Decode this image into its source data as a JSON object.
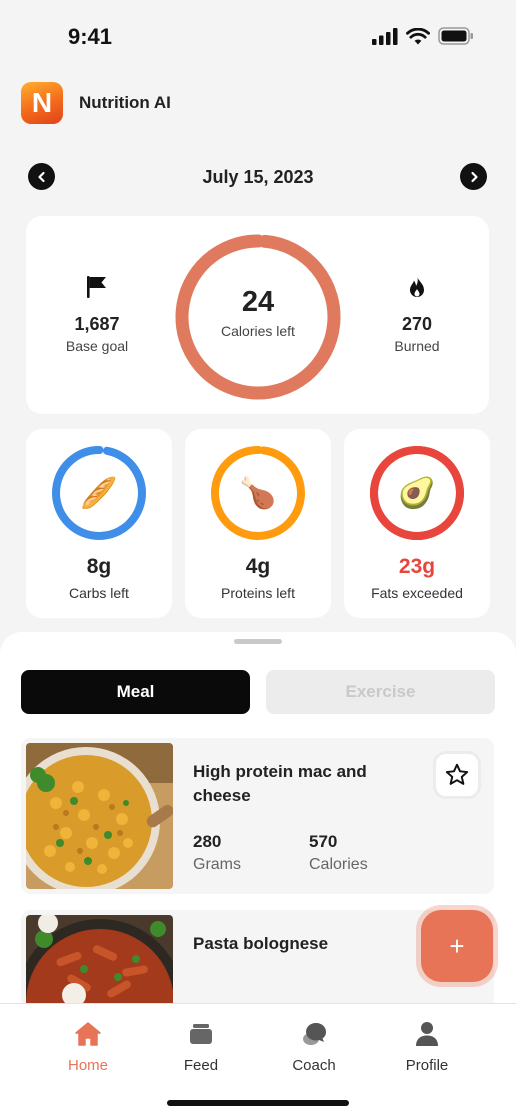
{
  "status_bar": {
    "time": "9:41"
  },
  "app": {
    "logo_letter": "N",
    "title": "Nutrition AI"
  },
  "date_nav": {
    "date": "July 15, 2023"
  },
  "calories": {
    "base_goal_value": "1,687",
    "base_goal_label": "Base goal",
    "left_value": "24",
    "left_label": "Calories left",
    "burned_value": "270",
    "burned_label": "Burned",
    "ring_color": "#e07a5f",
    "progress_fraction": 0.985
  },
  "macros": [
    {
      "value": "8g",
      "label": "Carbs left",
      "color": "#3f8ee8",
      "track": "#e6f0fb",
      "progress_fraction": 0.97,
      "emoji": "🥖"
    },
    {
      "value": "4g",
      "label": "Proteins left",
      "color": "#ff9b0f",
      "track": "#fdf0dc",
      "progress_fraction": 0.98,
      "emoji": "🍗"
    },
    {
      "value": "23g",
      "label": "Fats exceeded",
      "color": "#e8453c",
      "track": "#e8453c",
      "progress_fraction": 1.0,
      "emoji": "🥑"
    }
  ],
  "tabs_segment": {
    "meal": "Meal",
    "exercise": "Exercise"
  },
  "meals": [
    {
      "name": "High protein mac and cheese",
      "grams_value": "280",
      "grams_label": "Grams",
      "calories_value": "570",
      "calories_label": "Calories"
    },
    {
      "name": "Pasta bolognese"
    }
  ],
  "fab": {
    "label": "+"
  },
  "bottom_nav": [
    {
      "label": "Home",
      "icon": "home-icon",
      "active": true
    },
    {
      "label": "Feed",
      "icon": "feed-icon",
      "active": false
    },
    {
      "label": "Coach",
      "icon": "coach-icon",
      "active": false
    },
    {
      "label": "Profile",
      "icon": "profile-icon",
      "active": false
    }
  ],
  "colors": {
    "accent": "#e87458",
    "dark": "#0a0a0a"
  }
}
